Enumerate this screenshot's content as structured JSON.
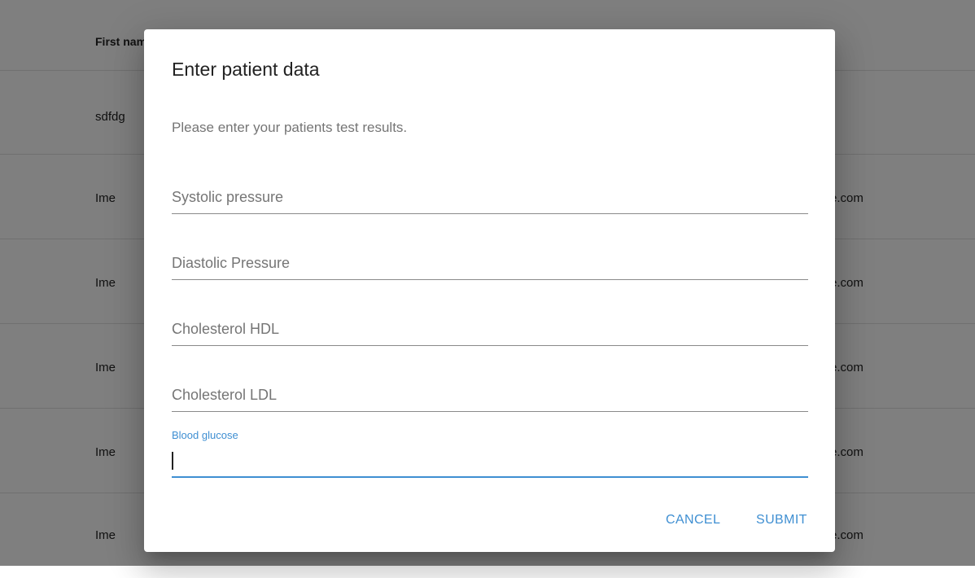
{
  "table": {
    "header": {
      "first_name": "First name"
    },
    "rows": [
      {
        "first": "sdfdg",
        "email": ""
      },
      {
        "first": "Ime",
        "email": "e.com"
      },
      {
        "first": "Ime",
        "email": "e.com"
      },
      {
        "first": "Ime",
        "email": "e.com"
      },
      {
        "first": "Ime",
        "email": "e.com"
      },
      {
        "first": "Ime",
        "email": "e.com"
      }
    ]
  },
  "dialog": {
    "title": "Enter patient data",
    "text": "Please enter your patients test results.",
    "fields": {
      "systolic": {
        "placeholder": "Systolic pressure",
        "value": ""
      },
      "diastolic": {
        "placeholder": "Diastolic Pressure",
        "value": ""
      },
      "hdl": {
        "placeholder": "Cholesterol HDL",
        "value": ""
      },
      "ldl": {
        "placeholder": "Cholesterol LDL",
        "value": ""
      },
      "glucose": {
        "label": "Blood glucose",
        "value": ""
      }
    },
    "cancel_label": "CANCEL",
    "submit_label": "SUBMIT",
    "accent_color": "#3f8fd2"
  }
}
